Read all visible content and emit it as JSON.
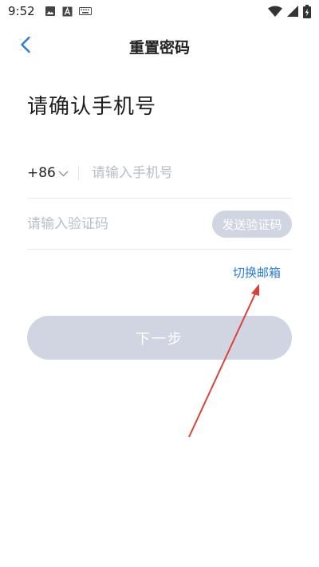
{
  "status_bar": {
    "time": "9:52"
  },
  "header": {
    "title": "重置密码"
  },
  "main": {
    "headline": "请确认手机号",
    "phone": {
      "country_code": "+86",
      "placeholder": "请输入手机号",
      "value": ""
    },
    "code": {
      "placeholder": "请输入验证码",
      "value": "",
      "send_button_label": "发送验证码"
    },
    "switch_link_label": "切换邮箱",
    "next_button_label": "下一步"
  },
  "colors": {
    "accent": "#2b7bd3",
    "button_disabled": "#d1d5e1",
    "placeholder": "#b9bdc7",
    "annotation_arrow": "#d9423a"
  },
  "icons": {
    "back": "chevron-left-icon",
    "dropdown": "chevron-down-icon",
    "status": [
      "image-icon",
      "text-a-icon",
      "keyboard-icon",
      "wifi-icon",
      "cell-signal-icon",
      "battery-icon"
    ]
  }
}
